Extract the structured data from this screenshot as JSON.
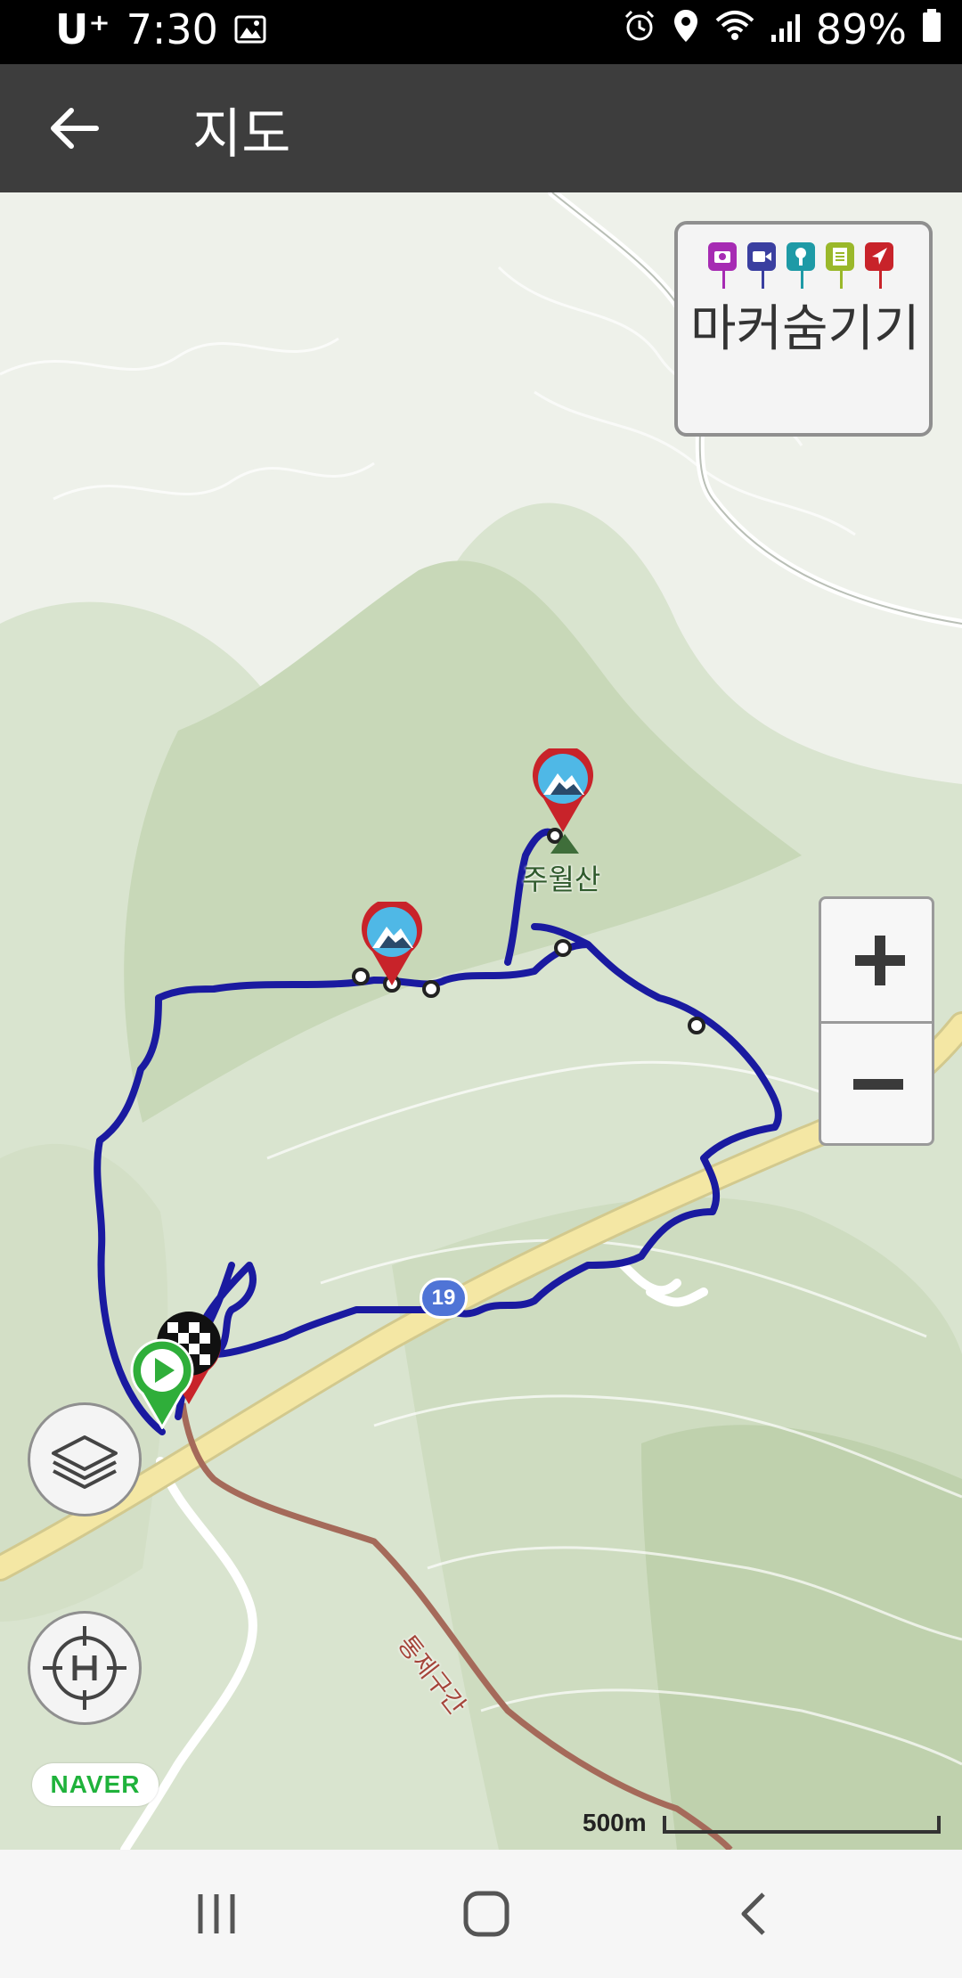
{
  "status_bar": {
    "carrier": "U⁺",
    "time": "7:30",
    "battery_percent": "89%",
    "icons": [
      "image-icon",
      "alarm-icon",
      "location-icon",
      "wifi-icon",
      "signal-icon",
      "battery-icon"
    ]
  },
  "app_bar": {
    "back_icon": "arrow-left-icon",
    "title": "지도"
  },
  "map": {
    "peak_label": "주월산",
    "road_number": "19",
    "restricted_label": "통제구간",
    "marker_panel": {
      "pin_icons": [
        "camera-icon",
        "video-icon",
        "mic-icon",
        "note-icon",
        "navigation-icon"
      ],
      "pin_colors": [
        "#a62bb3",
        "#3a3fa0",
        "#1e9aa6",
        "#9ab82a",
        "#c8232a"
      ],
      "label": "마커숨기기"
    },
    "zoom_in_label": "+",
    "zoom_out_label": "−",
    "layers_icon": "layers-icon",
    "home_locate_icon": "home-crosshair-icon",
    "provider": "NAVER",
    "scale_label": "500m",
    "track_color": "#1a1aa0",
    "start_marker": "start-play-icon",
    "finish_marker": "checkered-flag-icon",
    "photo_markers": [
      "mountain-photo-marker",
      "mountain-photo-marker"
    ]
  },
  "nav_bar": {
    "recent_icon": "recent-apps-icon",
    "home_icon": "home-circle-icon",
    "back_icon": "nav-back-icon"
  }
}
